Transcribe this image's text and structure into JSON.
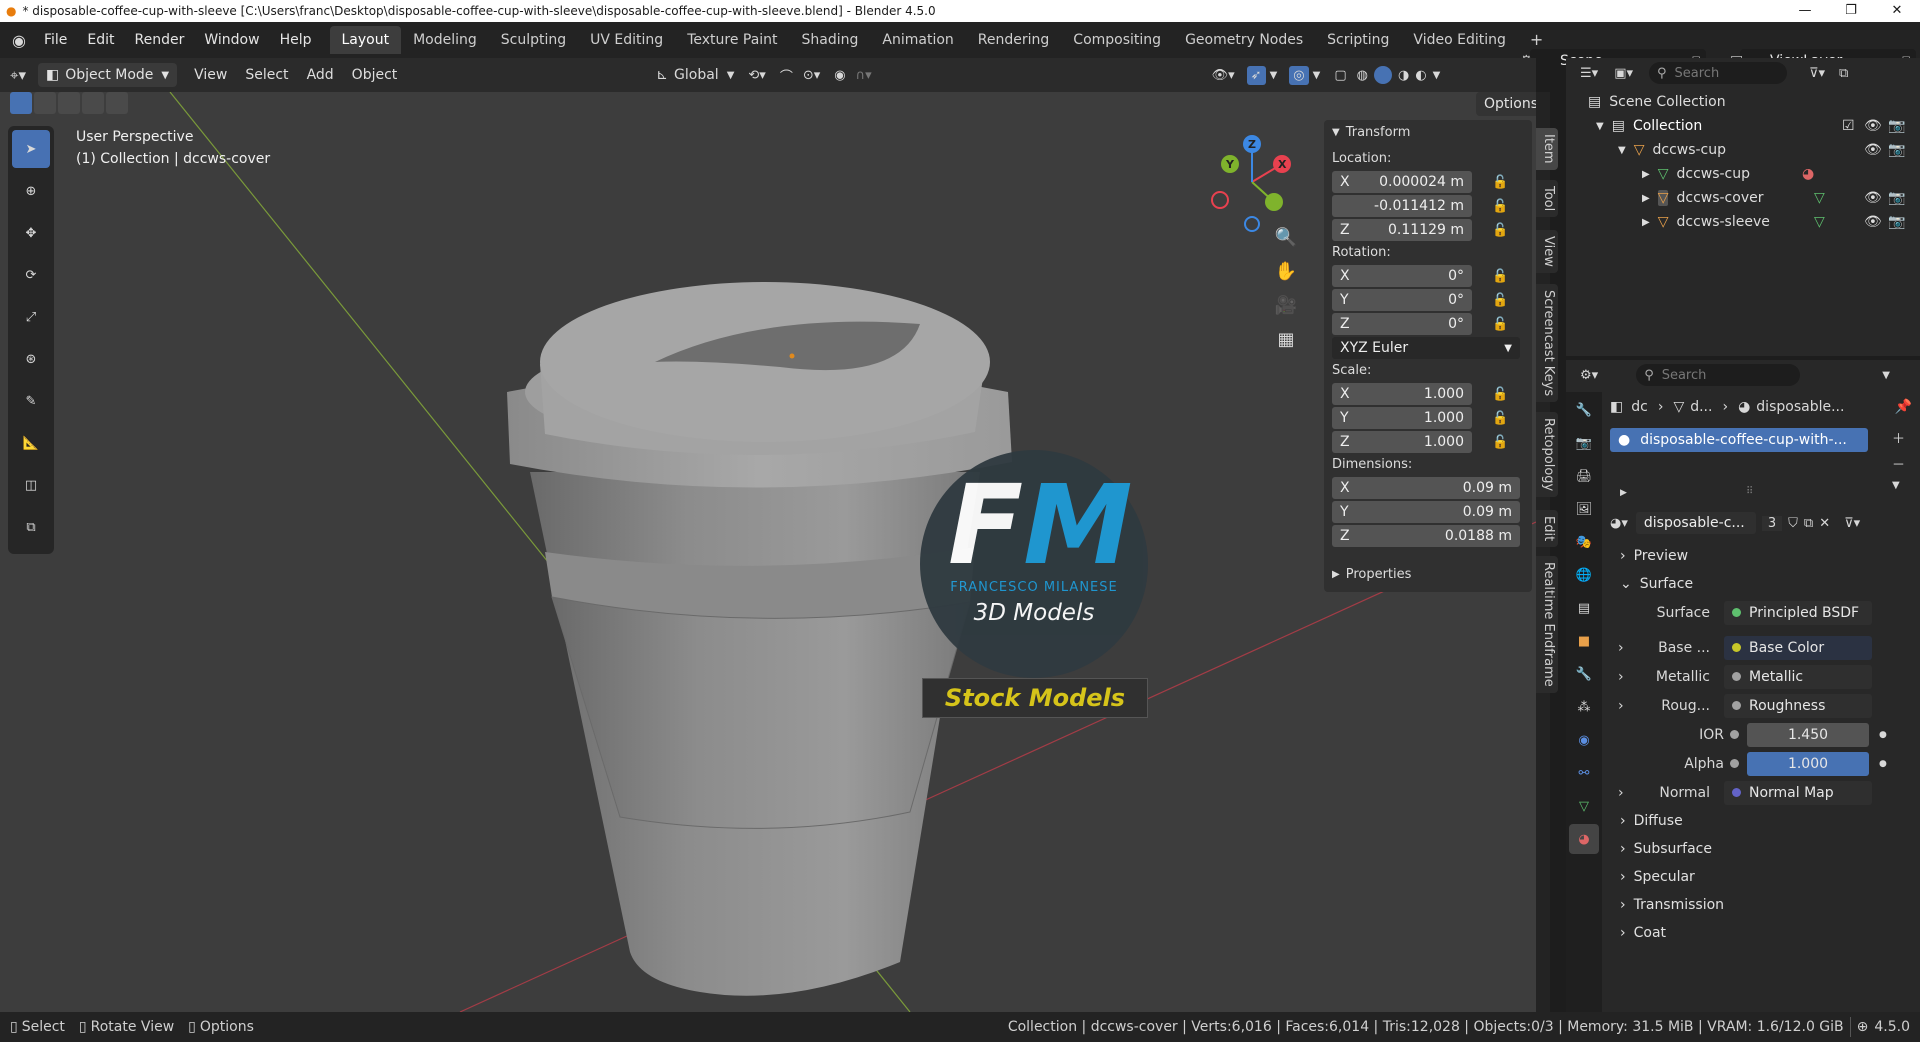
{
  "window": {
    "title": "* disposable-coffee-cup-with-sleeve [C:\\Users\\franc\\Desktop\\disposable-coffee-cup-with-sleeve\\disposable-coffee-cup-with-sleeve.blend] - Blender 4.5.0"
  },
  "menu": {
    "file": "File",
    "edit": "Edit",
    "render": "Render",
    "window": "Window",
    "help": "Help"
  },
  "workspaces": [
    "Layout",
    "Modeling",
    "Sculpting",
    "UV Editing",
    "Texture Paint",
    "Shading",
    "Animation",
    "Rendering",
    "Compositing",
    "Geometry Nodes",
    "Scripting",
    "Video Editing"
  ],
  "scene": {
    "name": "Scene",
    "view_layer": "ViewLayer"
  },
  "viewport_header": {
    "mode": "Object Mode",
    "view": "View",
    "select": "Select",
    "add": "Add",
    "object": "Object",
    "transform_orientation": "Global",
    "options": "Options"
  },
  "viewport": {
    "perspective": "User Perspective",
    "collection_info": "(1) Collection | dccws-cover"
  },
  "watermark": {
    "initials_f": "F",
    "initials_m": "M",
    "brand": "FRANCESCO MILANESE",
    "sub": "3D Models",
    "banner": "Stock Models"
  },
  "transform": {
    "title": "Transform",
    "location_label": "Location:",
    "location": {
      "x_label": "X",
      "x": "0.000024 m",
      "y": "-0.011412 m",
      "z_label": "Z",
      "z": "0.11129 m"
    },
    "rotation_label": "Rotation:",
    "rotation": {
      "x_label": "X",
      "x": "0°",
      "y_label": "Y",
      "y": "0°",
      "z_label": "Z",
      "z": "0°"
    },
    "rotation_mode": "XYZ Euler",
    "scale_label": "Scale:",
    "scale": {
      "x_label": "X",
      "x": "1.000",
      "y_label": "Y",
      "y": "1.000",
      "z_label": "Z",
      "z": "1.000"
    },
    "dimensions_label": "Dimensions:",
    "dimensions": {
      "x_label": "X",
      "x": "0.09 m",
      "y_label": "Y",
      "y": "0.09 m",
      "z_label": "Z",
      "z": "0.0188 m"
    },
    "properties": "Properties"
  },
  "side_tabs": [
    "Item",
    "Tool",
    "View",
    "Screencast Keys",
    "Retopology",
    "Edit",
    "Realtime Endframe"
  ],
  "outliner": {
    "search_placeholder": "Search",
    "scene_collection": "Scene Collection",
    "collection": "Collection",
    "items": [
      "dccws-cup",
      "dccws-cup",
      "dccws-cover",
      "dccws-sleeve"
    ]
  },
  "properties": {
    "search_placeholder": "Search",
    "breadcrumb": {
      "a": "dc",
      "b": "d...",
      "c": "disposable..."
    },
    "material_slot": "disposable-coffee-cup-with-...",
    "material_name": "disposable-c...",
    "material_users": "3",
    "preview": "Preview",
    "surface_section": "Surface",
    "surface_label": "Surface",
    "surface_value": "Principled BSDF",
    "sockets": [
      {
        "label": "Base ...",
        "value": "Base Color",
        "color": "#c7c729"
      },
      {
        "label": "Metallic",
        "value": "Metallic",
        "color": "#a1a1a1"
      },
      {
        "label": "Roug...",
        "value": "Roughness",
        "color": "#a1a1a1"
      }
    ],
    "ior": {
      "label": "IOR",
      "value": "1.450"
    },
    "alpha": {
      "label": "Alpha",
      "value": "1.000"
    },
    "normal": {
      "label": "Normal",
      "value": "Normal Map",
      "color": "#6363c7"
    },
    "subsections": [
      "Diffuse",
      "Subsurface",
      "Specular",
      "Transmission",
      "Coat"
    ]
  },
  "status": {
    "select": "Select",
    "rotate": "Rotate View",
    "options": "Options",
    "info": "Collection | dccws-cover | Verts:6,016 | Faces:6,014 | Tris:12,028 | Objects:0/3 | Memory: 31.5 MiB | VRAM: 1.6/12.0 GiB",
    "version": "4.5.0"
  },
  "colors": {
    "accent": "#4772b3",
    "alpha_field": "#4772b3",
    "gizmo_x": "#e8414f",
    "gizmo_y": "#7fb32c",
    "gizmo_z": "#3c88e3"
  }
}
